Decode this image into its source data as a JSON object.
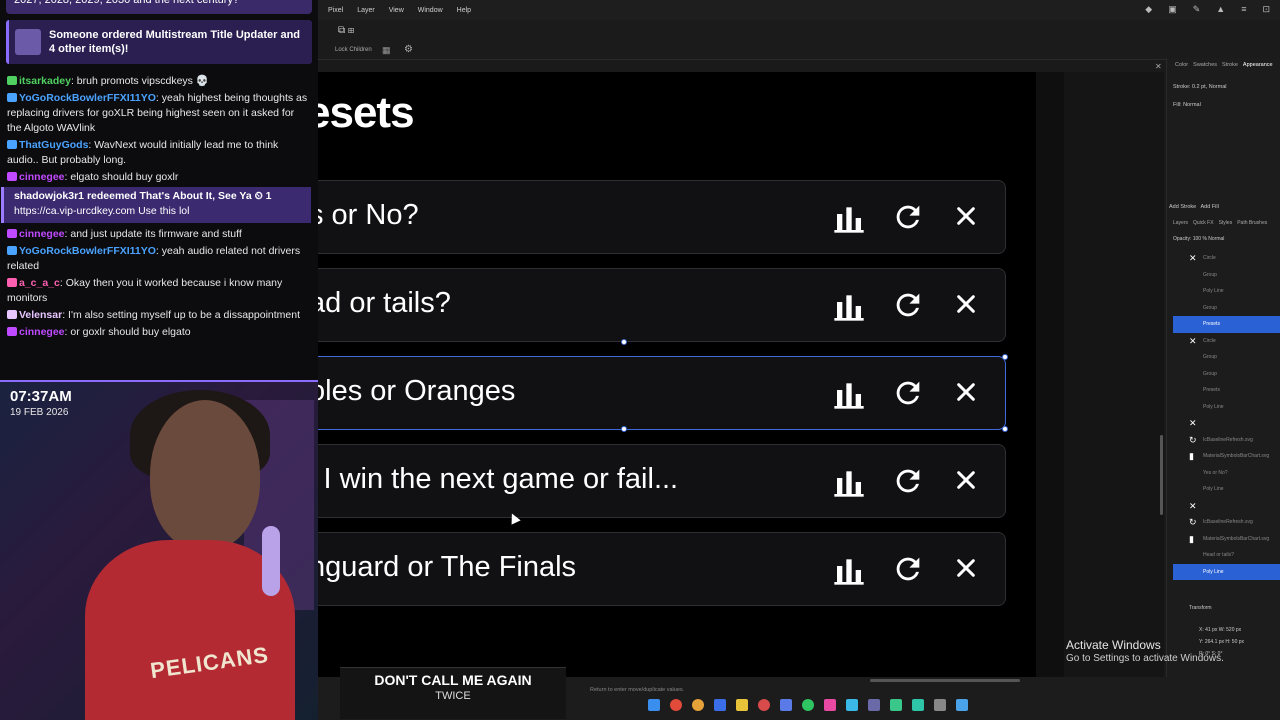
{
  "chat": {
    "top_banner": "2027, 2028, 2029, 2030 and the next century?",
    "sub_banner": "Someone ordered Multistream Title Updater and 4 other item(s)!",
    "messages": [
      {
        "user": "itsarkadey",
        "user_color": "#50d060",
        "text": ": bruh promots vipscdkeys 💀"
      },
      {
        "user": "YoGoRockBowlerFFXI11YO",
        "user_color": "#4aa3ff",
        "text": ": yeah highest being thoughts as replacing drivers for goXLR being highest seen on it asked for the Algoto WAVlink"
      },
      {
        "user": "ThatGuyGods",
        "user_color": "#4aa3ff",
        "text": ": WavNext would initially lead me to think audio.. But probably long."
      },
      {
        "user": "cinnegee",
        "user_color": "#c04aff",
        "text": ": elgato should buy goxlr"
      }
    ],
    "redeem": {
      "line1": "shadowjok3r1 redeemed That's About It, See Ya ⏲ 1",
      "line2": "https://ca.vip-urcdkey.com Use this lol"
    },
    "messages2": [
      {
        "user": "cinnegee",
        "user_color": "#c04aff",
        "text": ": and just update its firmware and stuff"
      },
      {
        "user": "YoGoRockBowlerFFXI11YO",
        "user_color": "#4aa3ff",
        "text": ": yeah audio related not drivers related"
      },
      {
        "user": "a_c_a_c",
        "user_color": "#ff5fb0",
        "text": ": Okay then you it worked because i know many monitors"
      },
      {
        "user": "Velensar",
        "user_color": "#e8c6ff",
        "text": ": I'm also setting myself up to be a dissappointment"
      },
      {
        "user": "cinnegee",
        "user_color": "#c04aff",
        "text": ": or goxlr should buy elgato"
      }
    ]
  },
  "webcam": {
    "time": "07:37AM",
    "date": "19 FEB 2026",
    "jersey_text": "PELICANS"
  },
  "menubar": {
    "items": [
      "Pixel",
      "Layer",
      "View",
      "Window",
      "Help"
    ]
  },
  "toolbar": {
    "lock_children": "Lock Children"
  },
  "canvas": {
    "title": "esets",
    "rows": [
      {
        "label": "s or No?"
      },
      {
        "label": "ad or tails?"
      },
      {
        "label": "oles or Oranges"
      },
      {
        "label": "l I win the next game or fail..."
      },
      {
        "label": "hguard or The Finals"
      }
    ],
    "icons": {
      "bar": "bar-chart-icon",
      "refresh": "refresh-icon",
      "close": "close-icon"
    }
  },
  "status": {
    "hint": "Return to enter move/duplicate values."
  },
  "song": {
    "title": "DON'T CALL ME AGAIN",
    "artist": "TWICE"
  },
  "right_panel": {
    "tabs": [
      "Color",
      "Swatches",
      "Stroke",
      "Appearance"
    ],
    "stroke": "Stroke: 0.2 pt,  Normal",
    "fill": "Fill:  Normal",
    "add_stroke": "Add Stroke",
    "add_fill": "Add Fill",
    "tabs2": [
      "Layers",
      "Quick FX",
      "Styles",
      "Path Brushes"
    ],
    "opacity": "Opacity:  100 %   Normal",
    "layers": [
      {
        "name": "Circle",
        "icon": "close-icon"
      },
      {
        "name": "Group",
        "icon": ""
      },
      {
        "name": "Poly Line",
        "icon": ""
      },
      {
        "name": "Group",
        "icon": ""
      },
      {
        "name": "Presets",
        "icon": "",
        "selected": true
      },
      {
        "name": "Circle",
        "icon": "close-icon"
      },
      {
        "name": "Group",
        "icon": ""
      },
      {
        "name": "Group",
        "icon": ""
      },
      {
        "name": "Presets",
        "icon": ""
      },
      {
        "name": "Poly Line",
        "icon": ""
      },
      {
        "name": "",
        "icon": "close-icon"
      },
      {
        "name": "IcBaselineRefresh.svg",
        "icon": "refresh-icon"
      },
      {
        "name": "MaterialSymbolsBarChart.svg",
        "icon": "bar-chart-icon"
      },
      {
        "name": "Yes or No?",
        "icon": ""
      },
      {
        "name": "Poly Line",
        "icon": ""
      },
      {
        "name": "",
        "icon": "close-icon"
      },
      {
        "name": "IcBaselineRefresh.svg",
        "icon": "refresh-icon"
      },
      {
        "name": "MaterialSymbolsBarChart.svg",
        "icon": "bar-chart-icon"
      },
      {
        "name": "Head or tails?",
        "icon": ""
      },
      {
        "name": "Poly Line",
        "icon": "",
        "selected": true
      }
    ],
    "transform": "Transform",
    "tx": [
      "X:  41 px     W:  520 px",
      "Y:  264.1 px   H:  50 px",
      "R:  0°         S:  0°"
    ]
  },
  "activate": {
    "line1": "Activate Windows",
    "line2": "Go to Settings to activate Windows."
  }
}
